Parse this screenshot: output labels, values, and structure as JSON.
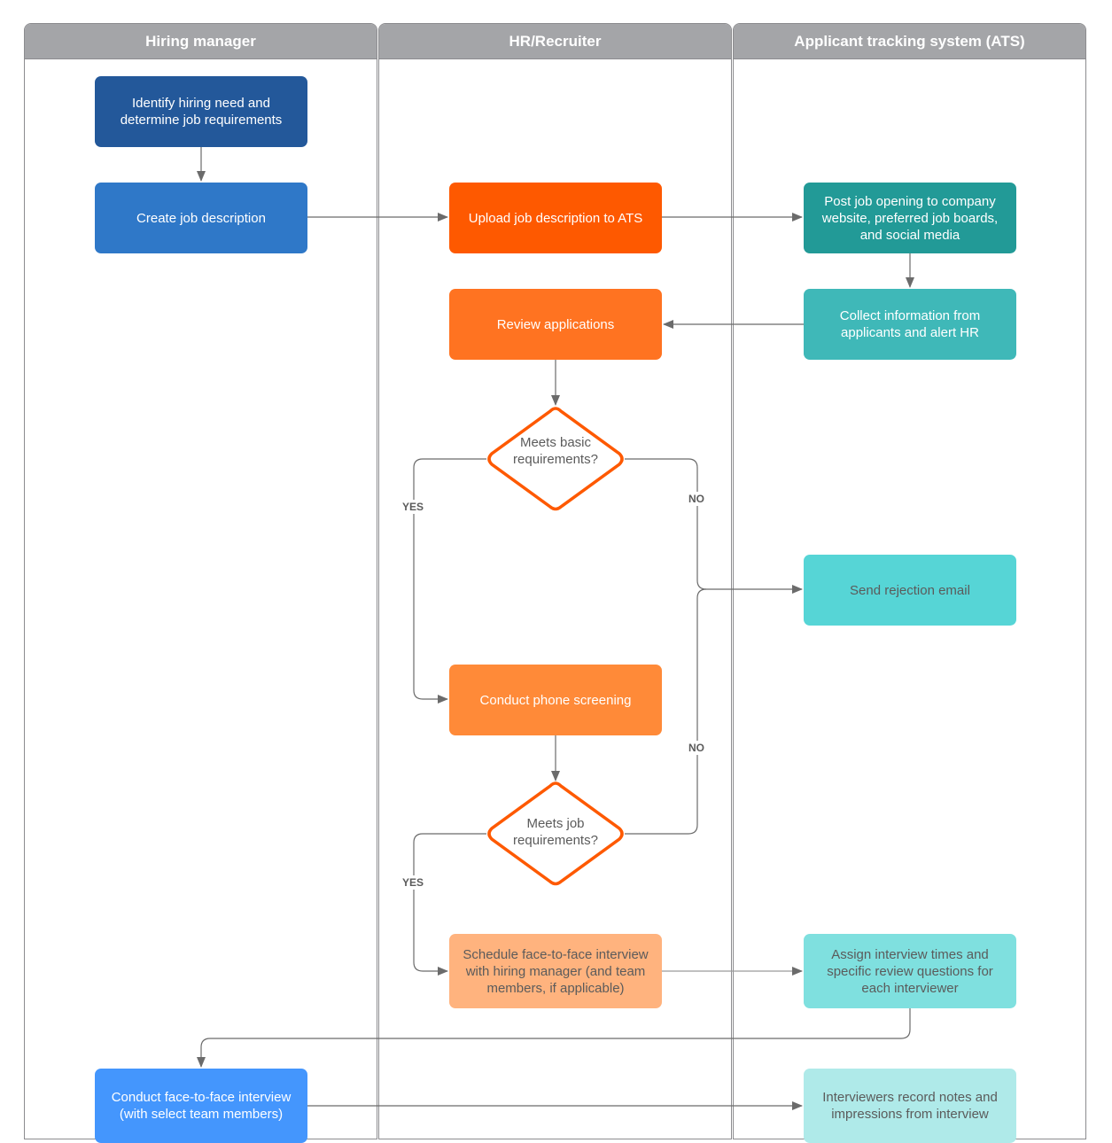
{
  "lanes": [
    {
      "title": "Hiring manager"
    },
    {
      "title": "HR/Recruiter"
    },
    {
      "title": "Applicant tracking system (ATS)"
    }
  ],
  "nodes": {
    "identify_need": {
      "label": "Identify hiring need and determine job requirements",
      "color": "#23589a"
    },
    "create_jd": {
      "label": "Create job description",
      "color": "#2f78c8"
    },
    "upload_jd": {
      "label": "Upload job description to ATS",
      "color": "#fe5900"
    },
    "post_job": {
      "label": "Post job opening to company website, preferred job boards, and social media",
      "color": "#229a97"
    },
    "collect_info": {
      "label": "Collect information from applicants and alert HR",
      "color": "#3fb8b8"
    },
    "review_apps": {
      "label": "Review applications",
      "color": "#ff7321"
    },
    "meets_basic": {
      "label": "Meets basic requirements?",
      "color": "#fe5900"
    },
    "send_rejection": {
      "label": "Send rejection email",
      "color": "#56d5d6"
    },
    "phone_screen": {
      "label": "Conduct phone screening",
      "color": "#ff8a38"
    },
    "meets_job": {
      "label": "Meets job requirements?",
      "color": "#fe5900"
    },
    "schedule_interview": {
      "label": "Schedule face-to-face interview with hiring manager (and team members, if applicable)",
      "color": "#ffb37e"
    },
    "assign_times": {
      "label": "Assign interview times and specific review questions for each interviewer",
      "color": "#7fe0df"
    },
    "conduct_interview": {
      "label": "Conduct face-to-face interview (with select team members)",
      "color": "#4496fd"
    },
    "record_notes": {
      "label": "Interviewers record notes and impressions from interview",
      "color": "#afeae9"
    }
  },
  "edge_labels": {
    "yes": "YES",
    "no": "NO"
  },
  "connector_color": "#6b6b6b"
}
